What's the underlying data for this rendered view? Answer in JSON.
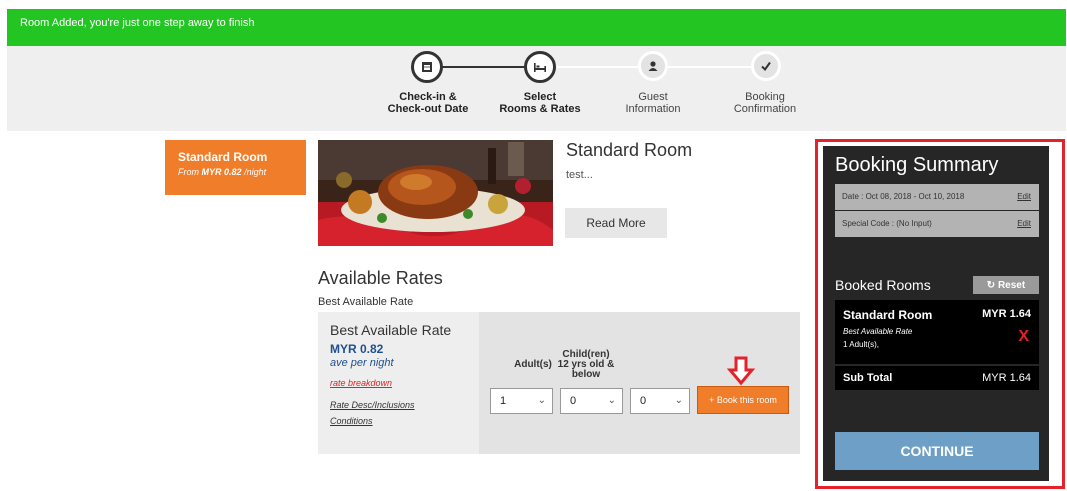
{
  "notification": {
    "text": "Room Added, you're just one step away to finish"
  },
  "steps": [
    {
      "label_line1": "Check-in &",
      "label_line2": "Check-out Date",
      "icon": "calendar-icon",
      "state": "done"
    },
    {
      "label_line1": "Select",
      "label_line2": "Rooms & Rates",
      "icon": "bed-icon",
      "state": "done"
    },
    {
      "label_line1": "Guest",
      "label_line2": "Information",
      "icon": "user-icon",
      "state": "todo"
    },
    {
      "label_line1": "Booking",
      "label_line2": "Confirmation",
      "icon": "check-icon",
      "state": "todo"
    }
  ],
  "room_tab": {
    "name": "Standard Room",
    "from_prefix": "From",
    "from_price": "MYR 0.82",
    "from_suffix": "/night"
  },
  "room": {
    "title": "Standard Room",
    "description": "test...",
    "read_more": "Read More"
  },
  "rates": {
    "title": "Available Rates",
    "subtitle": "Best Available Rate",
    "rate_name": "Best Available Rate",
    "price": "MYR 0.82",
    "per": "ave per night",
    "breakdown": "rate breakdown",
    "desc_link": "Rate Desc/Inclusions",
    "conditions_link": "Conditions",
    "adults_label": "Adult(s)",
    "child_label_1": "Child(ren)",
    "child_label_2": "12 yrs old &",
    "child_label_3": "below",
    "adults_value": "1",
    "children_value": "0",
    "extra_value": "0",
    "book_button": "+ Book this room"
  },
  "summary": {
    "title": "Booking Summary",
    "date_text": "Date : Oct 08, 2018 - Oct 10, 2018",
    "special_text": "Special Code : (No Input)",
    "edit_label": "Edit",
    "booked_title": "Booked Rooms",
    "reset_label": "Reset",
    "item_name": "Standard Room",
    "item_price": "MYR 1.64",
    "item_rate": "Best Available Rate",
    "item_adults": "1 Adult(s),",
    "remove_label": "X",
    "subtotal_label": "Sub Total",
    "subtotal_value": "MYR 1.64",
    "continue_label": "CONTINUE"
  },
  "colors": {
    "success": "#22c522",
    "accent": "#f07d2a",
    "summary_bg": "#262626",
    "highlight_frame": "#e5222b",
    "continue": "#6e9fc6"
  }
}
